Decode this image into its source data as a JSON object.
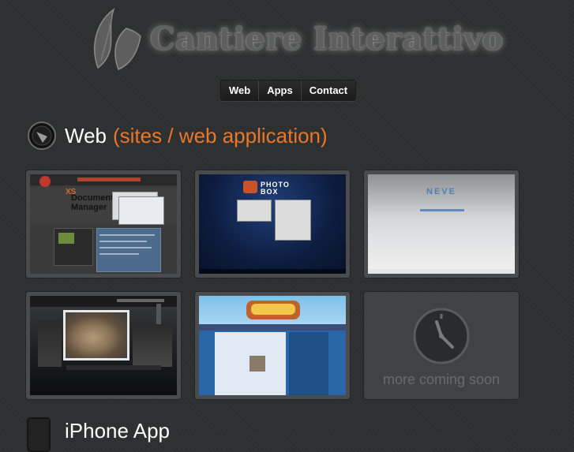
{
  "header": {
    "site_title": "Cantiere Interattivo",
    "logo_icon": "leaf-logo-icon"
  },
  "nav": {
    "items": [
      {
        "label": "Web"
      },
      {
        "label": "Apps"
      },
      {
        "label": "Contact"
      }
    ]
  },
  "web_section": {
    "title": "Web",
    "subtitle": "(sites / web application)",
    "accent_color": "#e8782b",
    "icon": "compass-globe-icon",
    "tiles": [
      {
        "id": "xs-documents-manager",
        "logo_line1": "XS",
        "logo_line2": "Documents",
        "logo_line3": "Manager"
      },
      {
        "id": "photo-box",
        "logo_text": "PHOTO BOX"
      },
      {
        "id": "neve",
        "logo_text": "NEVE"
      },
      {
        "id": "cat-gallery"
      },
      {
        "id": "blue-blog"
      },
      {
        "id": "coming-soon",
        "text": "more coming soon"
      }
    ]
  },
  "iphone_section": {
    "title": "iPhone App",
    "icon": "iphone-icon"
  }
}
